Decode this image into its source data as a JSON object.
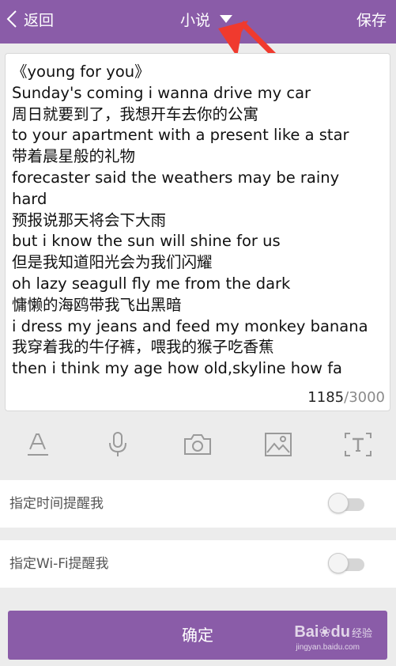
{
  "header": {
    "back_label": "返回",
    "title": "小说",
    "save_label": "保存"
  },
  "editor": {
    "lines": [
      "《young for you》",
      "Sunday's coming i wanna drive my car",
      "周日就要到了，我想开车去你的公寓",
      "to your apartment with a present like a star",
      "带着晨星般的礼物",
      "forecaster said the weathers may be rainy",
      "hard",
      "预报说那天将会下大雨",
      "but i know the sun will shine for us",
      "但是我知道阳光会为我们闪耀",
      "oh lazy seagull fly me from the dark",
      "慵懒的海鸥带我飞出黑暗",
      "i dress my jeans and feed my monkey banana",
      "我穿着我的牛仔裤，喂我的猴子吃香蕉",
      "then i think my age how old,skyline how fa"
    ],
    "count": "1185",
    "separator": "/",
    "max": "3000"
  },
  "toolbar": {
    "icons": [
      "text-format-icon",
      "microphone-icon",
      "camera-icon",
      "image-icon",
      "text-recognition-icon"
    ]
  },
  "options": {
    "time_reminder_label": "指定时间提醒我",
    "time_reminder_on": false,
    "wifi_reminder_label": "指定Wi-Fi提醒我",
    "wifi_reminder_on": false
  },
  "confirm_label": "确定",
  "watermark": {
    "logo": "Bai",
    "logo_tail": "du",
    "cn": "经验",
    "url": "jingyan.baidu.com"
  },
  "colors": {
    "accent": "#8a5ca8",
    "annotation_arrow": "#f03a2e",
    "background": "#ececec",
    "icon_gray": "#9a9a9a"
  }
}
